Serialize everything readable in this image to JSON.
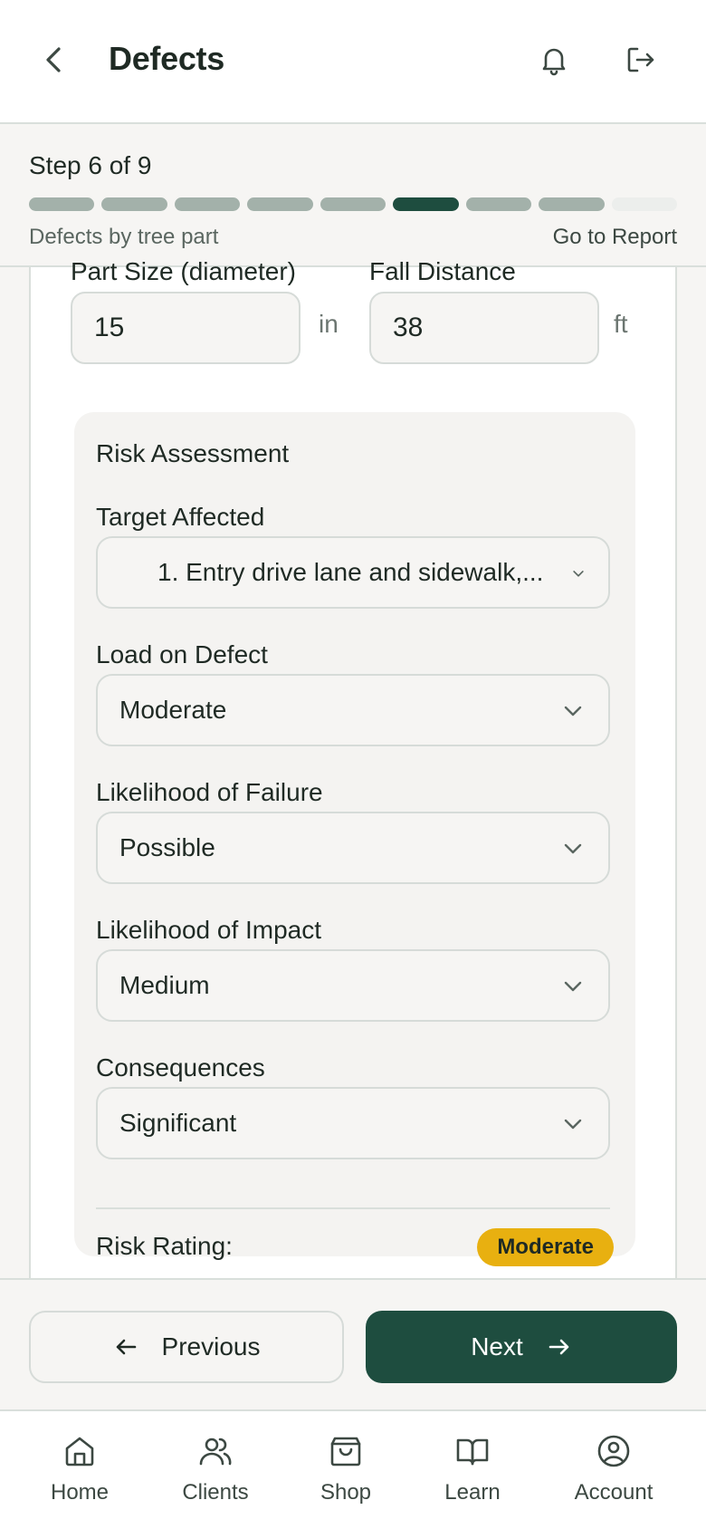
{
  "header": {
    "title": "Defects",
    "icons": {
      "back": "chevron-left-icon",
      "bell": "bell-icon",
      "logout": "logout-icon"
    }
  },
  "progress": {
    "step_label": "Step 6 of 9",
    "current_step": 6,
    "total_steps": 9,
    "subtitle": "Defects by tree part",
    "report_link": "Go to Report"
  },
  "form": {
    "part_size": {
      "label": "Part Size (diameter)",
      "value": "15",
      "unit": "in"
    },
    "fall_distance": {
      "label": "Fall Distance",
      "value": "38",
      "unit": "ft"
    },
    "risk": {
      "title": "Risk Assessment",
      "target_affected": {
        "label": "Target Affected",
        "value": "1. Entry drive lane and sidewalk,..."
      },
      "load_on_defect": {
        "label": "Load on Defect",
        "value": "Moderate"
      },
      "likelihood_failure": {
        "label": "Likelihood of Failure",
        "value": "Possible"
      },
      "likelihood_impact": {
        "label": "Likelihood of Impact",
        "value": "Medium"
      },
      "consequences": {
        "label": "Consequences",
        "value": "Significant"
      },
      "rating_label": "Risk Rating:",
      "rating_value": "Moderate"
    }
  },
  "actions": {
    "previous": "Previous",
    "next": "Next"
  },
  "tabs": [
    {
      "label": "Home",
      "icon": "home-icon"
    },
    {
      "label": "Clients",
      "icon": "users-icon"
    },
    {
      "label": "Shop",
      "icon": "shopping-bag-icon"
    },
    {
      "label": "Learn",
      "icon": "book-icon"
    },
    {
      "label": "Account",
      "icon": "account-icon"
    }
  ],
  "colors": {
    "primary": "#1e4d3f",
    "progress_done": "#a3b1aa",
    "badge_moderate": "#e8b010",
    "background": "#f6f5f3"
  }
}
